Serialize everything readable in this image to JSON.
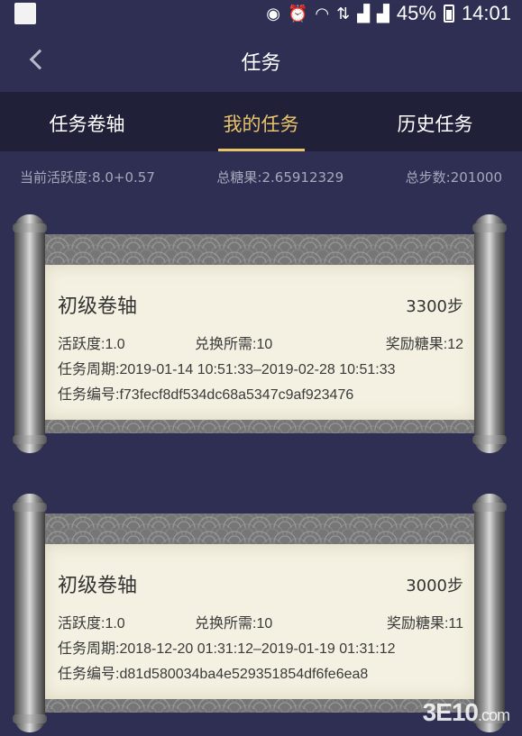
{
  "status_bar": {
    "battery": "45%",
    "time": "14:01",
    "icons": [
      "location-hd-icon",
      "alarm-icon",
      "wifi-icon",
      "4g-icon",
      "signal-icon",
      "signal-icon",
      "battery-icon"
    ]
  },
  "header": {
    "title": "任务"
  },
  "tabs": [
    {
      "label": "任务卷轴",
      "active": false
    },
    {
      "label": "我的任务",
      "active": true
    },
    {
      "label": "历史任务",
      "active": false
    }
  ],
  "stats": {
    "activity": "当前活跃度:8.0+0.57",
    "candy": "总糖果:2.65912329",
    "steps": "总步数:201000"
  },
  "cards": [
    {
      "title": "初级卷轴",
      "steps": "3300步",
      "activity": "活跃度:1.0",
      "exchange": "兑换所需:10",
      "reward": "奖励糖果:12",
      "period": "任务周期:2019-01-14 10:51:33–2019-02-28 10:51:33",
      "id": "任务编号:f73fecf8df534dc68a5347c9af923476"
    },
    {
      "title": "初级卷轴",
      "steps": "3000步",
      "activity": "活跃度:1.0",
      "exchange": "兑换所需:10",
      "reward": "奖励糖果:11",
      "period": "任务周期:2018-12-20 01:31:12–2019-01-19 01:31:12",
      "id": "任务编号:d81d580034ba4e529351854df6fe6ea8"
    }
  ],
  "watermark": {
    "brand": "3E10",
    "suffix": ".com"
  },
  "colors": {
    "background": "#2e2f52",
    "tab_bar": "#202138",
    "accent": "#e9c36a",
    "paper": "#f4f1e2"
  }
}
